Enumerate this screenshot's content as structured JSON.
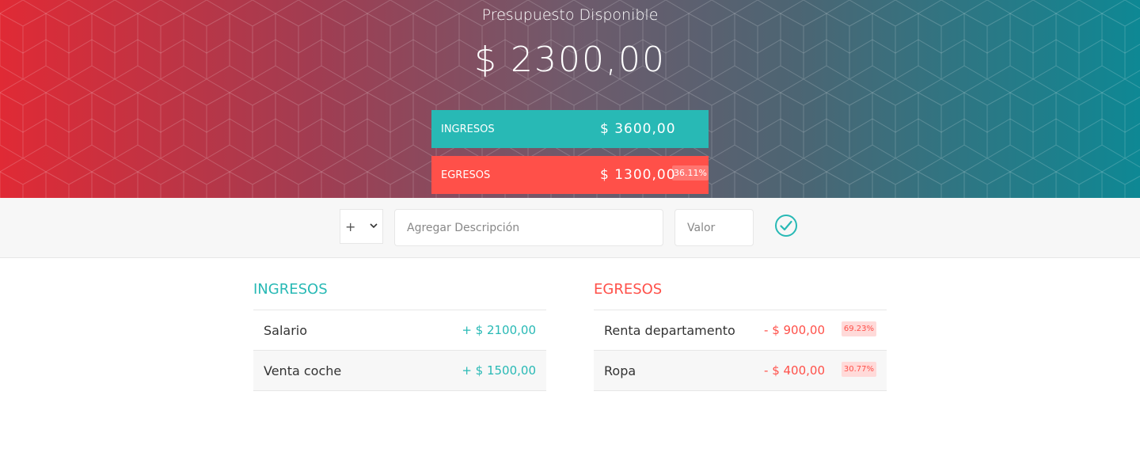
{
  "budget": {
    "title": "Presupuesto Disponible",
    "value": "$ 2300,00",
    "income_label": "Ingresos",
    "income_value": "$ 3600,00",
    "expense_label": "Egresos",
    "expense_value": "$ 1300,00",
    "expense_percentage": "36.11%"
  },
  "add": {
    "type_selected": "+",
    "description_placeholder": "Agregar Descripción",
    "value_placeholder": "Valor",
    "submit_icon": "checkmark-circle-icon"
  },
  "income": {
    "title": "Ingresos",
    "items": [
      {
        "description": "Salario",
        "value": "+ $ 2100,00"
      },
      {
        "description": "Venta coche",
        "value": "+ $ 1500,00"
      }
    ]
  },
  "expenses": {
    "title": "Egresos",
    "items": [
      {
        "description": "Renta departamento",
        "value": "- $ 900,00",
        "percentage": "69.23%"
      },
      {
        "description": "Ropa",
        "value": "- $ 400,00",
        "percentage": "30.77%"
      }
    ]
  },
  "colors": {
    "income": "#28b9b5",
    "expense": "#ff5049",
    "gradient_left": "#e02a35",
    "gradient_right": "#0e8894"
  }
}
